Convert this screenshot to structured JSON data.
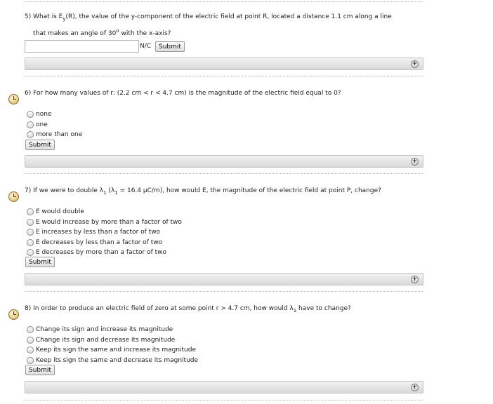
{
  "q5": {
    "line1_a": "5) What is E",
    "sub_y": "y",
    "line1_b": "(R), the value of the y-component of the electric field at point R, located a distance 1.1 cm along a line",
    "line2_a": "that makes an angle of 30",
    "deg": "o",
    "line2_b": " with the x-axis?",
    "input_value": "",
    "unit": "N/C",
    "submit": "Submit"
  },
  "q6": {
    "text": "6) For how many values of r: (2.2 cm < r < 4.7 cm) is the magnitude of the electric field equal to 0?",
    "options": [
      "none",
      "one",
      "more than one"
    ],
    "submit": "Submit"
  },
  "q7": {
    "text_a": "7) If we were to double λ",
    "sub1": "1",
    "text_b": " (λ",
    "sub2": "1",
    "text_c": " = 16.4 μC/m), how would E, the magnitude of the electric field at point P, change?",
    "options": [
      "E would double",
      "E would increase by more than a factor of two",
      "E increases by less than a factor of two",
      "E decreases by less than a factor of two",
      "E decreases by more than a factor of two"
    ],
    "submit": "Submit"
  },
  "q8": {
    "text_a": "8) In order to produce an electric field of zero at some point r > 4.7 cm, how would λ",
    "sub1": "1",
    "text_b": " have to change?",
    "options": [
      "Change its sign and increase its magnitude",
      "Change its sign and decrease its magnitude",
      "Keep its sign the same and increase its magnitude",
      "Keep its sign the same and decrease its magnitude"
    ],
    "submit": "Submit"
  },
  "icons": {
    "expand": "plus-circle-icon",
    "timer": "clock-icon",
    "expand_glyph": "+"
  }
}
